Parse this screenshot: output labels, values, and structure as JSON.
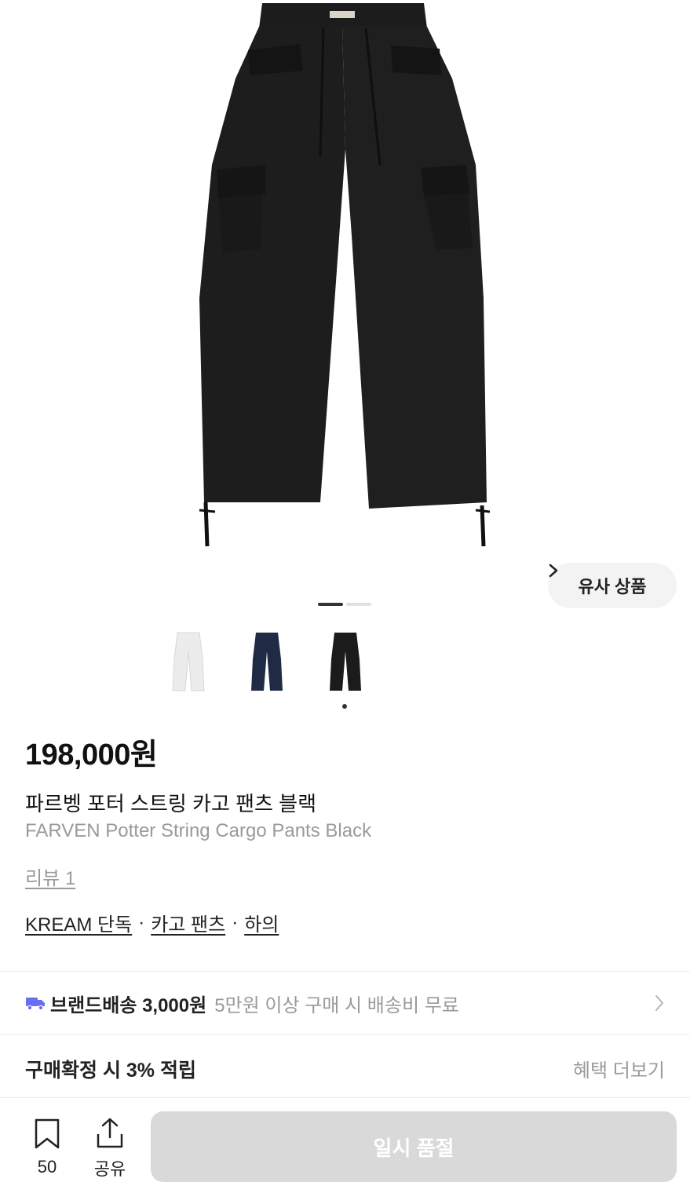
{
  "product": {
    "brand_label": "FARVEN",
    "price": "198,000원",
    "name_ko": "파르벵 포터 스트링 카고 팬츠 블랙",
    "name_en": "FARVEN Potter String Cargo Pants Black",
    "review": "리뷰 1",
    "tags": [
      "KREAM 단독",
      "카고 팬츠",
      "하의"
    ],
    "tag_separator": "·"
  },
  "gallery": {
    "similar_button": "유사 상품",
    "page_count": 2,
    "active_page": 1,
    "thumbnails": [
      {
        "color": "#ececec",
        "label": "white-pants-thumbnail"
      },
      {
        "color": "#1f2a44",
        "label": "navy-pants-thumbnail"
      },
      {
        "color": "#1b1b1b",
        "label": "black-pants-thumbnail"
      }
    ],
    "selected_thumbnail": 2
  },
  "shipping": {
    "label": "브랜드배송 3,000원",
    "note": "5만원 이상 구매 시 배송비 무료",
    "icon": "truck-icon",
    "icon_color": "#6a6ef5"
  },
  "points": {
    "label": "구매확정 시 3% 적립",
    "more": "혜택 더보기"
  },
  "bottom_bar": {
    "bookmark_count": "50",
    "share_label": "공유",
    "cta_label": "일시 품절"
  }
}
